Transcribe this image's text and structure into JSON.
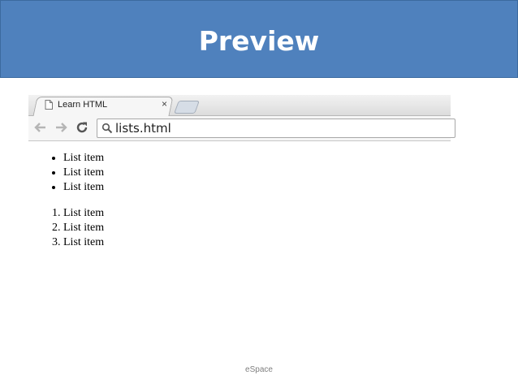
{
  "slide": {
    "title": "Preview",
    "footer": "eSpace"
  },
  "browser": {
    "tab_title": "Learn HTML",
    "close_glyph": "×",
    "url": "lists.html",
    "icons": {
      "tab": "page-icon",
      "back": "back-arrow-icon",
      "forward": "forward-arrow-icon",
      "reload": "reload-icon",
      "search": "search-icon"
    }
  },
  "page": {
    "unordered_list": [
      "List item",
      "List item",
      "List item"
    ],
    "ordered_list": [
      "List item",
      "List item",
      "List item"
    ]
  },
  "colors": {
    "title_bar": "#4f81bd",
    "title_text": "#ffffff"
  }
}
